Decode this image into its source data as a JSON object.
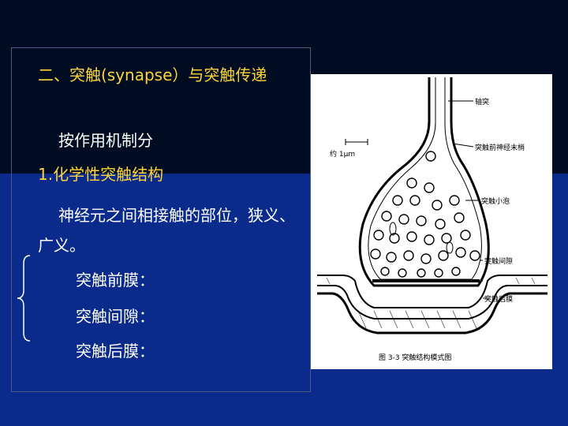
{
  "slide": {
    "title": "二、突触(synapse）与突触传递",
    "line_classify": "按作用机制分",
    "heading_chemical": "1.化学性突触结构",
    "definition": "神经元之间相接触的部位，狭义、广义。",
    "items": [
      "突触前膜：",
      "突触间隙：",
      "突触后膜："
    ]
  },
  "figure": {
    "labels": {
      "axon": "轴突",
      "terminal": "突触前神经末梢",
      "vesicle": "突触小泡",
      "cleft": "突触间隙",
      "postsynaptic": "突触后膜",
      "scale": "约 1μm"
    },
    "caption": "图 3-3  突触结构模式图"
  },
  "colors": {
    "top_bg": "#000c22",
    "bottom_bg": "#0a2a8c",
    "title": "#ffd43a",
    "text": "#ffffff"
  }
}
